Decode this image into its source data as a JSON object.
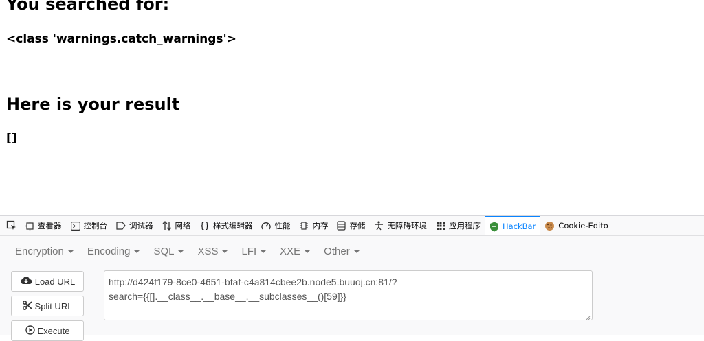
{
  "page": {
    "heading_searched": "You searched for:",
    "query_value": "<class 'warnings.catch_warnings'>",
    "heading_result": "Here is your result",
    "result_value": "[]"
  },
  "devtools": {
    "tabs": [
      {
        "label": "查看器",
        "icon": "inspector-icon"
      },
      {
        "label": "控制台",
        "icon": "console-icon"
      },
      {
        "label": "调试器",
        "icon": "debugger-icon"
      },
      {
        "label": "网络",
        "icon": "network-icon"
      },
      {
        "label": "样式编辑器",
        "icon": "style-editor-icon"
      },
      {
        "label": "性能",
        "icon": "performance-icon"
      },
      {
        "label": "内存",
        "icon": "memory-icon"
      },
      {
        "label": "存储",
        "icon": "storage-icon"
      },
      {
        "label": "无障碍环境",
        "icon": "accessibility-icon"
      },
      {
        "label": "应用程序",
        "icon": "application-icon"
      },
      {
        "label": "HackBar",
        "icon": "hackbar-icon",
        "selected": true
      },
      {
        "label": "Cookie-Edito",
        "icon": "cookie-icon"
      }
    ],
    "accent_color": "#0a84ff"
  },
  "hackbar": {
    "menu": [
      "Encryption",
      "Encoding",
      "SQL",
      "XSS",
      "LFI",
      "XXE",
      "Other"
    ],
    "load_url": "Load URL",
    "split_url": "Split URL",
    "execute": "Execute",
    "url_line1": "http://d424f179-8ce0-4651-bfaf-c4a814cbee2b.node5.buuoj.cn:81/?",
    "url_line2": "search={{[].__class__.__base__.__subclasses__()[59]}}"
  }
}
